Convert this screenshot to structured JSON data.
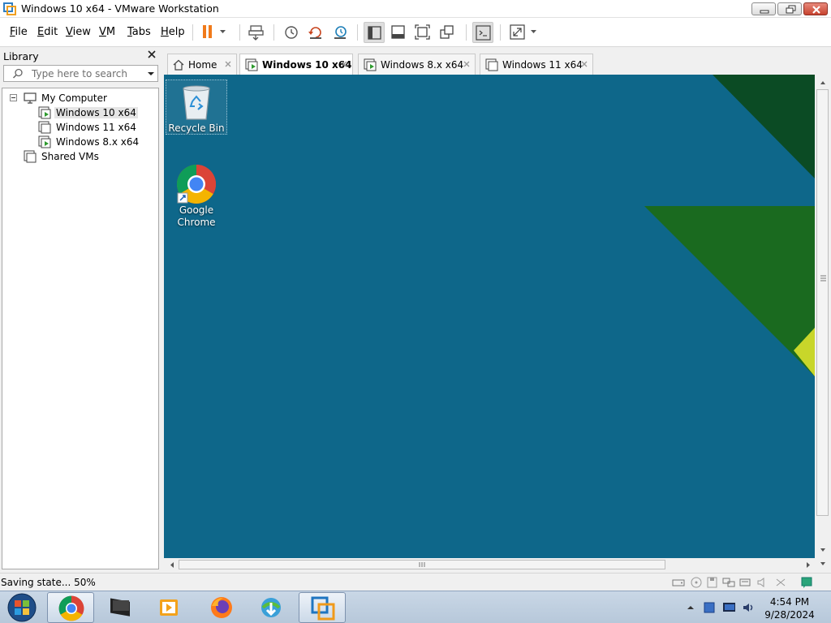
{
  "window": {
    "title": "Windows 10 x64 - VMware Workstation"
  },
  "menu": {
    "file": "File",
    "edit": "Edit",
    "view": "View",
    "vm": "VM",
    "tabs": "Tabs",
    "help": "Help"
  },
  "toolbar": {
    "icons": [
      "pause-icon",
      "send-ctrl-alt-del-icon",
      "snapshot-icon",
      "revert-snapshot-icon",
      "snapshot-manager-icon",
      "show-library-icon",
      "thumbnail-bar-icon",
      "full-screen-icon",
      "unity-icon",
      "console-view-icon",
      "stretch-guest-icon"
    ]
  },
  "library": {
    "title": "Library",
    "search_placeholder": "Type here to search",
    "tree": [
      {
        "label": "My Computer",
        "level": 0,
        "icon": "computer-icon"
      },
      {
        "label": "Windows 10 x64",
        "level": 1,
        "icon": "vm-running-icon",
        "selected": true
      },
      {
        "label": "Windows 11 x64",
        "level": 1,
        "icon": "vm-icon"
      },
      {
        "label": "Windows 8.x x64",
        "level": 1,
        "icon": "vm-running-icon"
      },
      {
        "label": "Shared VMs",
        "level": 0,
        "icon": "shared-vms-icon"
      }
    ]
  },
  "tabs": [
    {
      "label": "Home",
      "icon": "home-icon",
      "active": false
    },
    {
      "label": "Windows 10 x64",
      "icon": "vm-running-icon",
      "active": true
    },
    {
      "label": "Windows 8.x x64",
      "icon": "vm-running-icon",
      "active": false
    },
    {
      "label": "Windows 11 x64",
      "icon": "vm-icon",
      "active": false
    }
  ],
  "desktop": {
    "icons": [
      {
        "label": "Recycle Bin",
        "icon": "recycle-bin-icon"
      },
      {
        "label": "Google Chrome",
        "icon": "chrome-icon"
      }
    ],
    "colors": {
      "background": "#0e678a",
      "dark_green": "#0b4b24",
      "green": "#1a6a1f",
      "yellow": "#c8d62a"
    }
  },
  "statusbar": {
    "text": "Saving state... 50%",
    "progress_percent": 50
  },
  "taskbar": {
    "apps": [
      "windows-start-icon",
      "chrome-icon",
      "terminal-icon",
      "media-player-icon",
      "firefox-icon",
      "download-manager-icon",
      "vmware-icon"
    ],
    "time": "4:54 PM",
    "date": "9/28/2024"
  }
}
